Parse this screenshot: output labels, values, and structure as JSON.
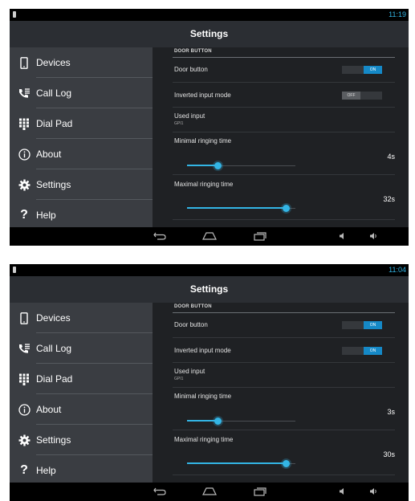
{
  "screens": [
    {
      "clock": "11:19",
      "title": "Settings",
      "nav": [
        "Devices",
        "Call Log",
        "Dial Pad",
        "About",
        "Settings",
        "Help"
      ],
      "section_header": "DOOR BUTTON",
      "door_button": {
        "label": "Door button",
        "toggle": "ON",
        "state": "on"
      },
      "inverted_input": {
        "label": "Inverted input mode",
        "toggle": "OFF",
        "state": "off"
      },
      "used_input": {
        "label": "Used input",
        "value": "GPI1"
      },
      "min_ring": {
        "label": "Minimal ringing time",
        "value": "4s",
        "level": 0.28
      },
      "max_ring": {
        "label": "Maximal ringing time",
        "value": "32s",
        "level": 0.91
      }
    },
    {
      "clock": "11:04",
      "title": "Settings",
      "nav": [
        "Devices",
        "Call Log",
        "Dial Pad",
        "About",
        "Settings",
        "Help"
      ],
      "section_header": "DOOR BUTTON",
      "door_button": {
        "label": "Door button",
        "toggle": "ON",
        "state": "on"
      },
      "inverted_input": {
        "label": "Inverted input mode",
        "toggle": "ON",
        "state": "on"
      },
      "used_input": {
        "label": "Used input",
        "value": "GPI1"
      },
      "min_ring": {
        "label": "Minimal ringing time",
        "value": "3s",
        "level": 0.28
      },
      "max_ring": {
        "label": "Maximal ringing time",
        "value": "30s",
        "level": 0.91
      }
    }
  ],
  "icons": {
    "nav": [
      "phone-icon",
      "call-log-icon",
      "dialpad-icon",
      "info-icon",
      "gear-icon",
      "help-icon"
    ],
    "system": [
      "back-icon",
      "home-icon",
      "recent-apps-icon",
      "volume-down-icon",
      "volume-up-icon"
    ]
  },
  "colors": {
    "accent": "#33b5e5",
    "toggle_on": "#1589c7"
  }
}
